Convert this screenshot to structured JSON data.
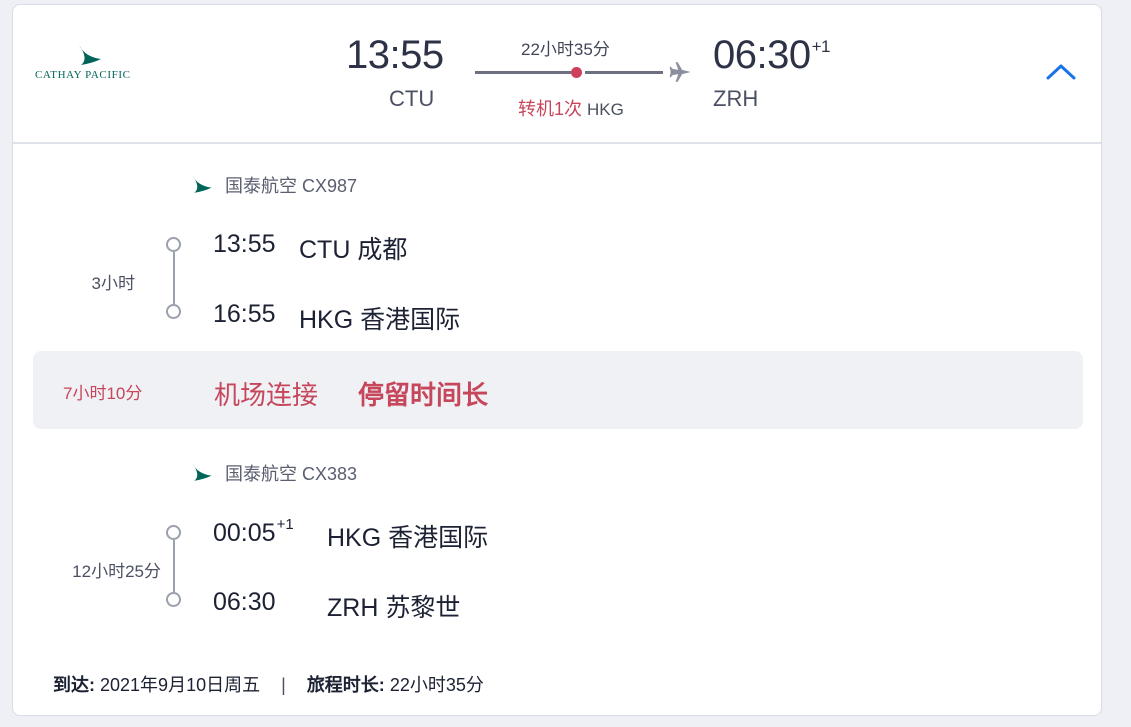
{
  "header": {
    "airline_logo_text": "CATHAY PACIFIC",
    "depart_time": "13:55",
    "depart_code": "CTU",
    "total_duration": "22小时35分",
    "arrive_time": "06:30",
    "arrive_day_offset": "+1",
    "arrive_code": "ZRH",
    "transfer_label": "转机1次",
    "transfer_airport": "HKG"
  },
  "segments": [
    {
      "airline": "国泰航空 CX987",
      "duration": "3小时",
      "dep_time": "13:55",
      "dep_offset": "",
      "dep_place": "CTU 成都",
      "arr_time": "16:55",
      "arr_place": "HKG 香港国际"
    },
    {
      "airline": "国泰航空 CX383",
      "duration": "12小时25分",
      "dep_time": "00:05",
      "dep_offset": "+1",
      "dep_place": "HKG 香港国际",
      "arr_time": "06:30",
      "arr_place": "ZRH 苏黎世"
    }
  ],
  "layover": {
    "duration": "7小时10分",
    "type": "机场连接",
    "warning": "停留时间长"
  },
  "footer": {
    "arrive_label": "到达:",
    "arrive_date": "2021年9月10日周五",
    "separator": "|",
    "duration_label": "旅程时长:",
    "duration_value": "22小时35分"
  },
  "colors": {
    "accent_red": "#c6465c",
    "chevron_blue": "#1a73e8",
    "brand_teal": "#00645a"
  },
  "icons": [
    "cathay-logo-icon",
    "plane-icon",
    "chevron-up-icon",
    "airline-logo-icon"
  ]
}
